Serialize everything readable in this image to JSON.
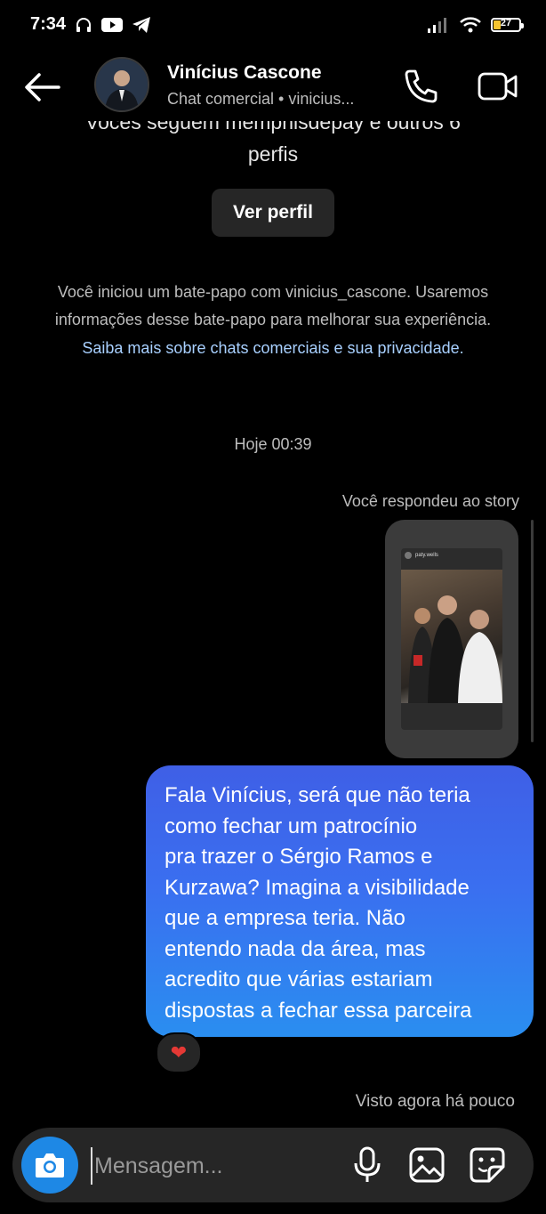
{
  "status_bar": {
    "time": "7:34",
    "battery_level": "27"
  },
  "header": {
    "name": "Vinícius Cascone",
    "subtitle": "Chat comercial • vinicius..."
  },
  "profile_intro": {
    "cut_line": "Vocês seguem memphisdepay e outros 6",
    "cut_line_2": "perfis",
    "view_profile_label": "Ver perfil"
  },
  "info": {
    "line1": "Você iniciou um bate-papo com vinicius_cascone. Usaremos",
    "line2": "informações desse bate-papo para melhorar sua experiência.",
    "link": "Saiba mais sobre chats comerciais e sua privacidade."
  },
  "thread": {
    "date_label": "Hoje 00:39",
    "replied_label": "Você respondeu ao story",
    "story_user": "paty.wells",
    "message": "Fala Vinícius, será que não teria\ncomo fechar um patrocínio\npra trazer o Sérgio Ramos e\nKurzawa? Imagina a visibilidade\nque a empresa teria. Não\nentendo nada da área, mas\nacredito que várias estariam\ndispostas a fechar essa parceira",
    "reaction": "❤",
    "seen_label": "Visto agora há pouco"
  },
  "composer": {
    "placeholder": "Mensagem..."
  },
  "colors": {
    "bubble_top": "#3f5fe6",
    "bubble_bottom": "#2a8ef0",
    "camera_button": "#1e88e5",
    "link": "#a8d0ff"
  }
}
